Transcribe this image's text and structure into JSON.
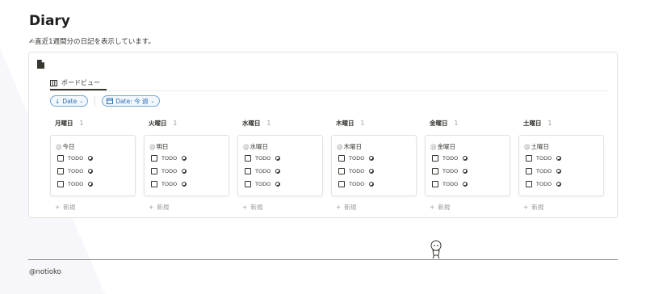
{
  "page": {
    "title": "Diary",
    "description_emoji": "✍",
    "description": "直近1週間分の日記を表示しています。"
  },
  "view": {
    "tab_label": "ボードビュー",
    "tab_icon": "board-icon"
  },
  "filters": [
    {
      "label": "Date",
      "prefix_icon": "arrow-down-icon",
      "suffix_icon": "chevron-down-icon"
    },
    {
      "label": "Date: 今 週",
      "prefix_icon": "calendar-icon",
      "suffix_icon": "chevron-down-icon"
    }
  ],
  "columns": [
    {
      "title": "月曜日",
      "count": "1",
      "card": {
        "at": "@",
        "name": "今日",
        "todos": [
          "TODO",
          "TODO",
          "TODO"
        ]
      },
      "new_label": "新規"
    },
    {
      "title": "火曜日",
      "count": "1",
      "card": {
        "at": "@",
        "name": "明日",
        "todos": [
          "TODO",
          "TODO",
          "TODO"
        ]
      },
      "new_label": "新規"
    },
    {
      "title": "水曜日",
      "count": "1",
      "card": {
        "at": "@",
        "name": "水曜日",
        "todos": [
          "TODO",
          "TODO",
          "TODO"
        ]
      },
      "new_label": "新規"
    },
    {
      "title": "木曜日",
      "count": "1",
      "card": {
        "at": "@",
        "name": "木曜日",
        "todos": [
          "TODO",
          "TODO",
          "TODO"
        ]
      },
      "new_label": "新規"
    },
    {
      "title": "金曜日",
      "count": "1",
      "card": {
        "at": "@",
        "name": "金曜日",
        "todos": [
          "TODO",
          "TODO",
          "TODO"
        ]
      },
      "new_label": "新規"
    },
    {
      "title": "土曜日",
      "count": "1",
      "card": {
        "at": "@",
        "name": "土曜日",
        "todos": [
          "TODO",
          "TODO",
          "TODO"
        ]
      },
      "new_label": "新規"
    }
  ],
  "footer": {
    "handle": "@notioko"
  },
  "colors": {
    "accent": "#2a6fb5",
    "text": "#37352f",
    "muted": "#9b9a97"
  }
}
